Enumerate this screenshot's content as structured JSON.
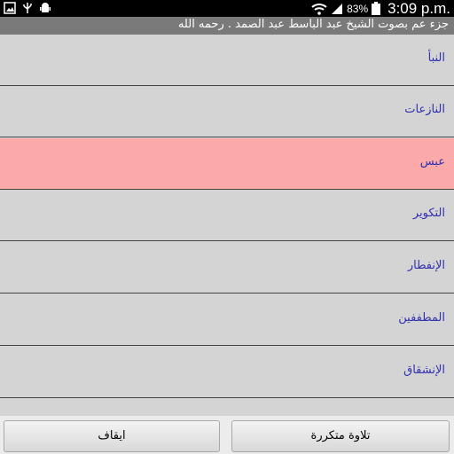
{
  "status_bar": {
    "left_icons": [
      "photo-icon",
      "usb-debug-icon",
      "android-icon"
    ],
    "battery_percent": "83%",
    "time": "3:09 p.m."
  },
  "title": "جزء عم بصوت الشيخ عبد الباسط عبد الصمد . رحمه الله",
  "list": {
    "items": [
      {
        "label": "النبأ"
      },
      {
        "label": "النازعات"
      },
      {
        "label": "عبس"
      },
      {
        "label": "التكوير"
      },
      {
        "label": "الإنفطار"
      },
      {
        "label": "المطففين"
      },
      {
        "label": "الإنشقاق"
      }
    ],
    "selected_index": 2
  },
  "buttons": {
    "stop": "ايقاف",
    "repeat": "تلاوة متكررة"
  },
  "colors": {
    "status_bar": "#000000",
    "title_bar": "#7a7a7a",
    "list_background": "#d4d4d4",
    "selected_row": "#fba9a9",
    "item_text": "#3030b0"
  }
}
